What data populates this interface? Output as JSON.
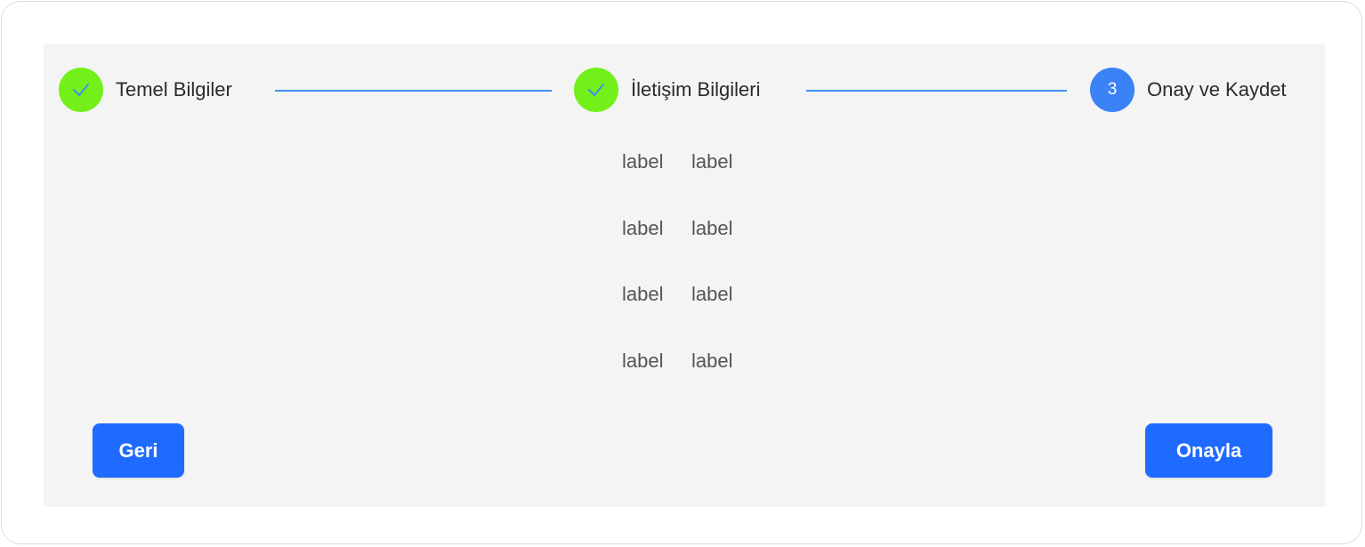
{
  "stepper": {
    "steps": [
      {
        "label": "Temel Bilgiler",
        "status": "completed",
        "icon": "check-icon"
      },
      {
        "label": "İletişim Bilgileri",
        "status": "completed",
        "icon": "check-icon"
      },
      {
        "label": "Onay ve Kaydet",
        "status": "active",
        "number": "3"
      }
    ]
  },
  "summary": {
    "rows": [
      {
        "key": "label",
        "value": "label"
      },
      {
        "key": "label",
        "value": "label"
      },
      {
        "key": "label",
        "value": "label"
      },
      {
        "key": "label",
        "value": "label"
      }
    ]
  },
  "actions": {
    "back_label": "Geri",
    "confirm_label": "Onayla"
  },
  "colors": {
    "completed_step": "#73f01a",
    "active_step": "#3b82f6",
    "connector": "#3b8ff0",
    "button": "#1f6bff",
    "panel_background": "#f4f4f4"
  }
}
